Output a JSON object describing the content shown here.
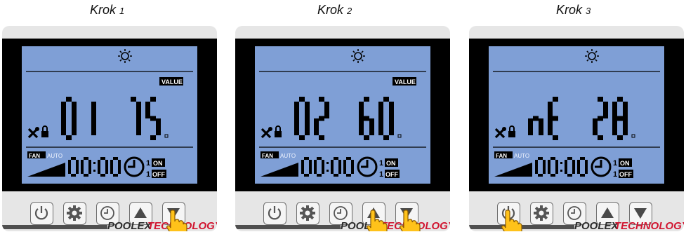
{
  "steps": [
    {
      "title_word": "Krok",
      "title_num": "1",
      "display": {
        "value_tag": "VALUE",
        "left_digits": "01",
        "right_digits": "75",
        "show_value_tag": true
      },
      "pressed_buttons": [
        "down"
      ]
    },
    {
      "title_word": "Krok",
      "title_num": "2",
      "display": {
        "value_tag": "VALUE",
        "left_digits": "02",
        "right_digits": "60",
        "show_value_tag": true
      },
      "pressed_buttons": [
        "up",
        "down"
      ]
    },
    {
      "title_word": "Krok",
      "title_num": "3",
      "display": {
        "value_tag": "",
        "left_digits": "nE",
        "right_digits": "28",
        "show_value_tag": false
      },
      "pressed_buttons": [
        "power"
      ]
    }
  ],
  "lcd": {
    "fan_label": "FAN",
    "auto_label": "AUTO",
    "clock": "00:00",
    "on_num": "1",
    "on_label": "ON",
    "off_num": "1",
    "off_label": "OFF",
    "sun_icon": "sun-icon",
    "lock_icon": "lock-icon",
    "tools_icon": "tools-icon"
  },
  "buttons": [
    {
      "id": "power",
      "icon": "power-icon"
    },
    {
      "id": "settings",
      "icon": "gear-icon"
    },
    {
      "id": "clock",
      "icon": "clock-icon"
    },
    {
      "id": "up",
      "icon": "triangle-up-icon"
    },
    {
      "id": "down",
      "icon": "triangle-down-icon"
    }
  ],
  "brand": {
    "poolex": "POOLEX",
    "technology": "TECHNOLOGY"
  },
  "colors": {
    "lcd_bg": "#7f9fd6",
    "bezel": "#000000",
    "panel": "#e6e6e6",
    "brand_red": "#d11530",
    "hand_yellow": "#ffc21a"
  }
}
